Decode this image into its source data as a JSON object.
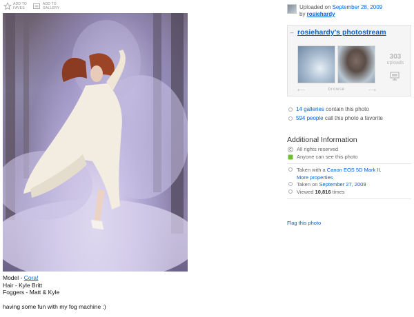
{
  "actions": {
    "favorite_label": "ADD TO\nFAVES",
    "gallery_label": "ADD TO\nGALLERY"
  },
  "caption": {
    "model_prefix": "Model - ",
    "model_name": "Cora!",
    "hair": "Hair - Kyle Britt",
    "foggers": "Foggers - Matt & Kyle",
    "description": "having some fun with my fog machine :)"
  },
  "uploader": {
    "uploaded_prefix": "Uploaded on ",
    "date": "September 28, 2009",
    "by_prefix": "by ",
    "username": "rosiehardy"
  },
  "photostream": {
    "collapse_symbol": "–",
    "title": "rosiehardy's photostream",
    "uploads_count": "303",
    "uploads_label": "uploads",
    "browse_label": "browse",
    "prev_arrow": "⟵",
    "next_arrow": "⟶"
  },
  "stats": {
    "galleries_link": "14 galleries",
    "galleries_suffix": " contain this photo",
    "favorites_link": "594 people",
    "favorites_suffix": " call this photo a favorite"
  },
  "additional_info": {
    "title": "Additional Information",
    "license": "All rights reserved",
    "privacy": "Anyone can see this photo",
    "camera_prefix": "Taken with a ",
    "camera": "Canon EOS 5D Mark II.",
    "more_properties": "More properties",
    "taken_prefix": "Taken on ",
    "taken_date": "September 27, 2009",
    "viewed_prefix": "Viewed ",
    "view_count": "10,816",
    "viewed_suffix": " times"
  },
  "flag": "Flag this photo",
  "icons": {
    "favorite": "star-icon",
    "gallery": "gallery-icon",
    "license": "copyright-icon",
    "privacy": "public-icon",
    "slideshow": "slideshow-icon"
  },
  "colors": {
    "link": "#0063dc",
    "privacy_green": "#6cbf2f"
  }
}
